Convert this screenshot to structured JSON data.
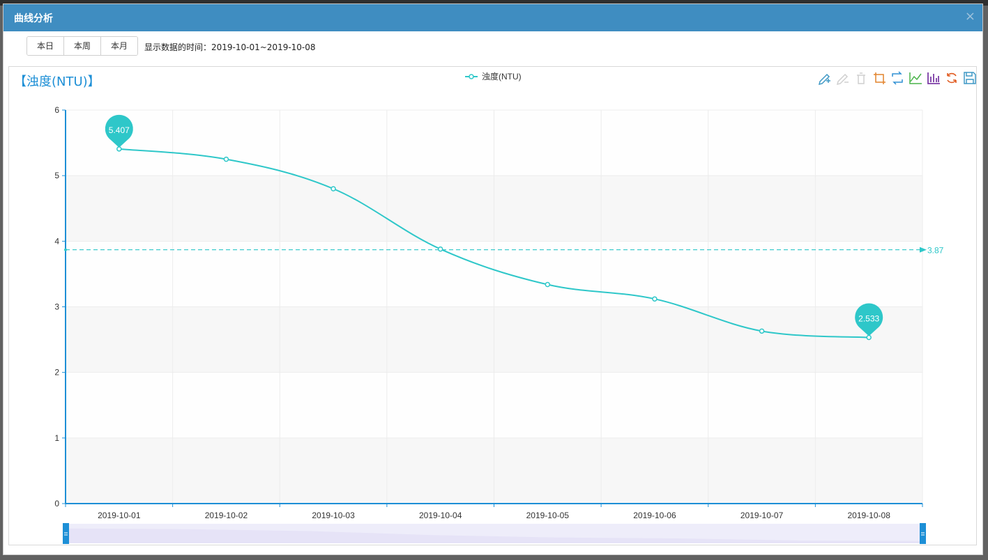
{
  "dialog": {
    "title": "曲线分析",
    "close_symbol": "×"
  },
  "toolbar": {
    "buttons": [
      "本日",
      "本周",
      "本月"
    ],
    "range_label": "显示数据的时间：2019-10-01~2019-10-08"
  },
  "chart_icons": [
    "mark-icon",
    "erase-mark-icon",
    "clear-mark-icon",
    "data-zoom-icon",
    "zoom-reset-icon",
    "line-chart-icon",
    "bar-chart-icon",
    "restore-icon",
    "save-image-icon"
  ],
  "chart_data": {
    "type": "line",
    "title": "【浊度(NTU)】",
    "legend": {
      "entries": [
        "浊度(NTU)"
      ],
      "position": "top-center"
    },
    "categories": [
      "2019-10-01",
      "2019-10-02",
      "2019-10-03",
      "2019-10-04",
      "2019-10-05",
      "2019-10-06",
      "2019-10-07",
      "2019-10-08"
    ],
    "series": [
      {
        "name": "浊度(NTU)",
        "values": [
          5.407,
          5.25,
          4.8,
          3.88,
          3.34,
          3.12,
          2.63,
          2.533
        ],
        "color": "#2ec7c9",
        "smooth": true
      }
    ],
    "ylim": [
      0,
      6
    ],
    "yticks": [
      "0",
      "1",
      "2",
      "3",
      "4",
      "5",
      "6"
    ],
    "grid": true,
    "mark_points": [
      {
        "label": "5.407",
        "category": "2019-10-01",
        "value": 5.407
      },
      {
        "label": "2.533",
        "category": "2019-10-08",
        "value": 2.533
      }
    ],
    "mark_line": {
      "label": "3.87",
      "value": 3.87
    },
    "axis_color": "#1d8fd6",
    "band_color": "#f7f7f7",
    "datazoom": {
      "start_fraction": 0,
      "end_fraction": 1,
      "fill": "#e8e5f8"
    }
  }
}
